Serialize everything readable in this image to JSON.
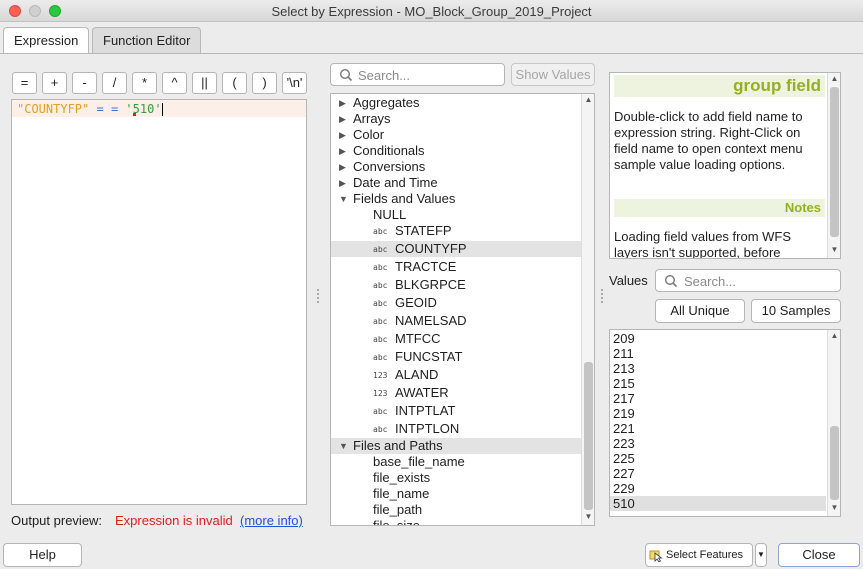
{
  "window": {
    "title": "Select by Expression - MO_Block_Group_2019_Project"
  },
  "tabs": [
    {
      "label": "Expression",
      "active": true
    },
    {
      "label": "Function Editor",
      "active": false
    }
  ],
  "operators": [
    "=",
    "+",
    "-",
    "/",
    "*",
    "^",
    "||",
    "(",
    ")",
    "'\\n'"
  ],
  "expression": {
    "field": "\"COUNTYFP\"",
    "op1": "=",
    "op2": "=",
    "value": "'510'"
  },
  "output": {
    "label": "Output preview:",
    "error": "Expression is invalid",
    "link": "(more info)"
  },
  "function_search": {
    "placeholder": "Search..."
  },
  "show_values_label": "Show Values",
  "tree": {
    "categories_top": [
      "Aggregates",
      "Arrays",
      "Color",
      "Conditionals",
      "Conversions",
      "Date and Time"
    ],
    "fields_category": "Fields and Values",
    "null_item": "NULL",
    "fields": [
      {
        "type": "abc",
        "name": "STATEFP"
      },
      {
        "type": "abc",
        "name": "COUNTYFP",
        "selected": true
      },
      {
        "type": "abc",
        "name": "TRACTCE"
      },
      {
        "type": "abc",
        "name": "BLKGRPCE"
      },
      {
        "type": "abc",
        "name": "GEOID"
      },
      {
        "type": "abc",
        "name": "NAMELSAD"
      },
      {
        "type": "abc",
        "name": "MTFCC"
      },
      {
        "type": "abc",
        "name": "FUNCSTAT"
      },
      {
        "type": "123",
        "name": "ALAND"
      },
      {
        "type": "123",
        "name": "AWATER"
      },
      {
        "type": "abc",
        "name": "INTPTLAT"
      },
      {
        "type": "abc",
        "name": "INTPTLON"
      }
    ],
    "files_category": "Files and Paths",
    "files_items": [
      "base_file_name",
      "file_exists",
      "file_name",
      "file_path",
      "file_size"
    ]
  },
  "help": {
    "heading": "group field",
    "body": "Double-click to add field name to expression string. Right-Click on field name to open context menu sample value loading options.",
    "notes_heading": "Notes",
    "notes_body": "Loading field values from WFS layers isn't supported, before"
  },
  "values": {
    "label": "Values",
    "search_placeholder": "Search...",
    "all_unique_label": "All Unique",
    "samples_label": "10 Samples",
    "items": [
      "209",
      "211",
      "213",
      "215",
      "217",
      "219",
      "221",
      "223",
      "225",
      "227",
      "229",
      "510"
    ],
    "selected": "510"
  },
  "buttons": {
    "help": "Help",
    "select_features": "Select Features",
    "close": "Close"
  },
  "colors": {
    "error": "#e0201a",
    "link": "#1f4fe0",
    "help_heading": "#93b023",
    "field_token": "#e0a020",
    "operator_token": "#3a72c8",
    "string_token": "#2f9f3a"
  }
}
